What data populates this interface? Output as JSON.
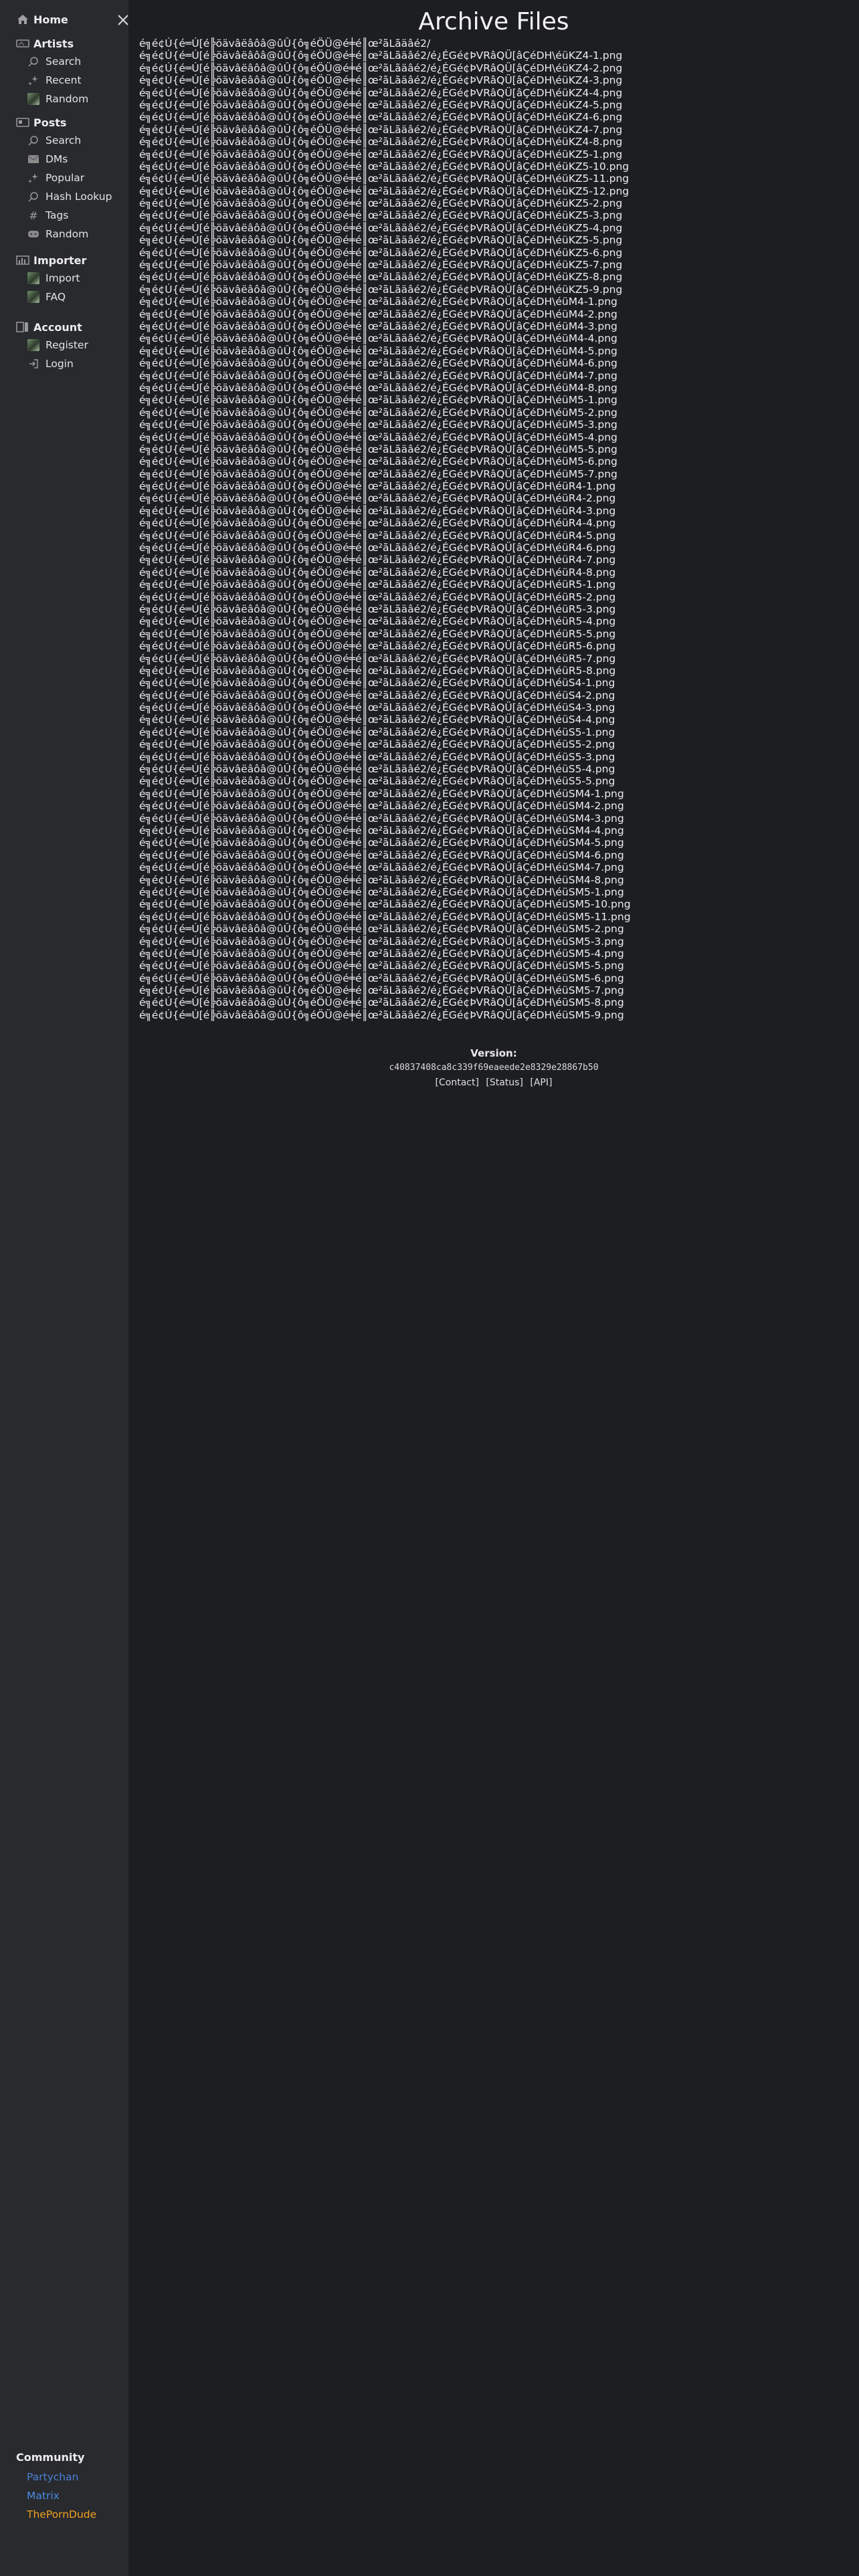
{
  "sidebar": {
    "home_label": "Home",
    "sections": [
      {
        "label": "Artists",
        "icon": "artist-icon",
        "items": [
          {
            "label": "Search",
            "icon": "search-icon"
          },
          {
            "label": "Recent",
            "icon": "sparkle-icon"
          },
          {
            "label": "Random",
            "icon": "image-thumb-icon"
          }
        ]
      },
      {
        "label": "Posts",
        "icon": "posts-icon",
        "items": [
          {
            "label": "Search",
            "icon": "search-icon"
          },
          {
            "label": "DMs",
            "icon": "mail-icon"
          },
          {
            "label": "Popular",
            "icon": "sparkle-icon"
          },
          {
            "label": "Hash Lookup",
            "icon": "search-icon"
          },
          {
            "label": "Tags",
            "icon": "hash-icon"
          },
          {
            "label": "Random",
            "icon": "dice-icon"
          }
        ]
      },
      {
        "label": "Importer",
        "icon": "importer-icon",
        "items": [
          {
            "label": "Import",
            "icon": "image-thumb-icon"
          },
          {
            "label": "FAQ",
            "icon": "image-thumb-icon"
          }
        ]
      },
      {
        "label": "Account",
        "icon": "account-icon",
        "items": [
          {
            "label": "Register",
            "icon": "image-thumb-icon"
          },
          {
            "label": "Login",
            "icon": "login-icon"
          }
        ]
      }
    ],
    "community": {
      "title": "Community",
      "links": [
        {
          "label": "Partychan",
          "color": "#4a7fd4"
        },
        {
          "label": "Matrix",
          "color": "#4a8ae6"
        },
        {
          "label": "ThePornDude",
          "color": "#f0a020"
        }
      ]
    }
  },
  "main": {
    "title": "Archive Files",
    "prefix": "é╗é¢Ú{é═Ú[é╠öävâëâôâ@ûÛ{ô╗éÖÜ@é╪é║œ²ãLãäâé2/",
    "files": [
      "",
      "é¿ÉGé¢ÞVRâQÜ[âÇéDH\\éüKZ4-1.png",
      "é¿ÉGé¢ÞVRâQÜ[âÇéDH\\éüKZ4-2.png",
      "é¿ÉGé¢ÞVRâQÜ[âÇéDH\\éüKZ4-3.png",
      "é¿ÉGé¢ÞVRâQÜ[âÇéDH\\éüKZ4-4.png",
      "é¿ÉGé¢ÞVRâQÜ[âÇéDH\\éüKZ4-5.png",
      "é¿ÉGé¢ÞVRâQÜ[âÇéDH\\éüKZ4-6.png",
      "é¿ÉGé¢ÞVRâQÜ[âÇéDH\\éüKZ4-7.png",
      "é¿ÉGé¢ÞVRâQÜ[âÇéDH\\éüKZ4-8.png",
      "é¿ÉGé¢ÞVRâQÜ[âÇéDH\\éüKZ5-1.png",
      "é¿ÉGé¢ÞVRâQÜ[âÇéDH\\éüKZ5-10.png",
      "é¿ÉGé¢ÞVRâQÜ[âÇéDH\\éüKZ5-11.png",
      "é¿ÉGé¢ÞVRâQÜ[âÇéDH\\éüKZ5-12.png",
      "é¿ÉGé¢ÞVRâQÜ[âÇéDH\\éüKZ5-2.png",
      "é¿ÉGé¢ÞVRâQÜ[âÇéDH\\éüKZ5-3.png",
      "é¿ÉGé¢ÞVRâQÜ[âÇéDH\\éüKZ5-4.png",
      "é¿ÉGé¢ÞVRâQÜ[âÇéDH\\éüKZ5-5.png",
      "é¿ÉGé¢ÞVRâQÜ[âÇéDH\\éüKZ5-6.png",
      "é¿ÉGé¢ÞVRâQÜ[âÇéDH\\éüKZ5-7.png",
      "é¿ÉGé¢ÞVRâQÜ[âÇéDH\\éüKZ5-8.png",
      "é¿ÉGé¢ÞVRâQÜ[âÇéDH\\éüKZ5-9.png",
      "é¿ÉGé¢ÞVRâQÜ[âÇéDH\\éüM4-1.png",
      "é¿ÉGé¢ÞVRâQÜ[âÇéDH\\éüM4-2.png",
      "é¿ÉGé¢ÞVRâQÜ[âÇéDH\\éüM4-3.png",
      "é¿ÉGé¢ÞVRâQÜ[âÇéDH\\éüM4-4.png",
      "é¿ÉGé¢ÞVRâQÜ[âÇéDH\\éüM4-5.png",
      "é¿ÉGé¢ÞVRâQÜ[âÇéDH\\éüM4-6.png",
      "é¿ÉGé¢ÞVRâQÜ[âÇéDH\\éüM4-7.png",
      "é¿ÉGé¢ÞVRâQÜ[âÇéDH\\éüM4-8.png",
      "é¿ÉGé¢ÞVRâQÜ[âÇéDH\\éüM5-1.png",
      "é¿ÉGé¢ÞVRâQÜ[âÇéDH\\éüM5-2.png",
      "é¿ÉGé¢ÞVRâQÜ[âÇéDH\\éüM5-3.png",
      "é¿ÉGé¢ÞVRâQÜ[âÇéDH\\éüM5-4.png",
      "é¿ÉGé¢ÞVRâQÜ[âÇéDH\\éüM5-5.png",
      "é¿ÉGé¢ÞVRâQÜ[âÇéDH\\éüM5-6.png",
      "é¿ÉGé¢ÞVRâQÜ[âÇéDH\\éüM5-7.png",
      "é¿ÉGé¢ÞVRâQÜ[âÇéDH\\éüR4-1.png",
      "é¿ÉGé¢ÞVRâQÜ[âÇéDH\\éüR4-2.png",
      "é¿ÉGé¢ÞVRâQÜ[âÇéDH\\éüR4-3.png",
      "é¿ÉGé¢ÞVRâQÜ[âÇéDH\\éüR4-4.png",
      "é¿ÉGé¢ÞVRâQÜ[âÇéDH\\éüR4-5.png",
      "é¿ÉGé¢ÞVRâQÜ[âÇéDH\\éüR4-6.png",
      "é¿ÉGé¢ÞVRâQÜ[âÇéDH\\éüR4-7.png",
      "é¿ÉGé¢ÞVRâQÜ[âÇéDH\\éüR4-8.png",
      "é¿ÉGé¢ÞVRâQÜ[âÇéDH\\éüR5-1.png",
      "é¿ÉGé¢ÞVRâQÜ[âÇéDH\\éüR5-2.png",
      "é¿ÉGé¢ÞVRâQÜ[âÇéDH\\éüR5-3.png",
      "é¿ÉGé¢ÞVRâQÜ[âÇéDH\\éüR5-4.png",
      "é¿ÉGé¢ÞVRâQÜ[âÇéDH\\éüR5-5.png",
      "é¿ÉGé¢ÞVRâQÜ[âÇéDH\\éüR5-6.png",
      "é¿ÉGé¢ÞVRâQÜ[âÇéDH\\éüR5-7.png",
      "é¿ÉGé¢ÞVRâQÜ[âÇéDH\\éüR5-8.png",
      "é¿ÉGé¢ÞVRâQÜ[âÇéDH\\éüS4-1.png",
      "é¿ÉGé¢ÞVRâQÜ[âÇéDH\\éüS4-2.png",
      "é¿ÉGé¢ÞVRâQÜ[âÇéDH\\éüS4-3.png",
      "é¿ÉGé¢ÞVRâQÜ[âÇéDH\\éüS4-4.png",
      "é¿ÉGé¢ÞVRâQÜ[âÇéDH\\éüS5-1.png",
      "é¿ÉGé¢ÞVRâQÜ[âÇéDH\\éüS5-2.png",
      "é¿ÉGé¢ÞVRâQÜ[âÇéDH\\éüS5-3.png",
      "é¿ÉGé¢ÞVRâQÜ[âÇéDH\\éüS5-4.png",
      "é¿ÉGé¢ÞVRâQÜ[âÇéDH\\éüS5-5.png",
      "é¿ÉGé¢ÞVRâQÜ[âÇéDH\\éüSM4-1.png",
      "é¿ÉGé¢ÞVRâQÜ[âÇéDH\\éüSM4-2.png",
      "é¿ÉGé¢ÞVRâQÜ[âÇéDH\\éüSM4-3.png",
      "é¿ÉGé¢ÞVRâQÜ[âÇéDH\\éüSM4-4.png",
      "é¿ÉGé¢ÞVRâQÜ[âÇéDH\\éüSM4-5.png",
      "é¿ÉGé¢ÞVRâQÜ[âÇéDH\\éüSM4-6.png",
      "é¿ÉGé¢ÞVRâQÜ[âÇéDH\\éüSM4-7.png",
      "é¿ÉGé¢ÞVRâQÜ[âÇéDH\\éüSM4-8.png",
      "é¿ÉGé¢ÞVRâQÜ[âÇéDH\\éüSM5-1.png",
      "é¿ÉGé¢ÞVRâQÜ[âÇéDH\\éüSM5-10.png",
      "é¿ÉGé¢ÞVRâQÜ[âÇéDH\\éüSM5-11.png",
      "é¿ÉGé¢ÞVRâQÜ[âÇéDH\\éüSM5-2.png",
      "é¿ÉGé¢ÞVRâQÜ[âÇéDH\\éüSM5-3.png",
      "é¿ÉGé¢ÞVRâQÜ[âÇéDH\\éüSM5-4.png",
      "é¿ÉGé¢ÞVRâQÜ[âÇéDH\\éüSM5-5.png",
      "é¿ÉGé¢ÞVRâQÜ[âÇéDH\\éüSM5-6.png",
      "é¿ÉGé¢ÞVRâQÜ[âÇéDH\\éüSM5-7.png",
      "é¿ÉGé¢ÞVRâQÜ[âÇéDH\\éüSM5-8.png",
      "é¿ÉGé¢ÞVRâQÜ[âÇéDH\\éüSM5-9.png"
    ]
  },
  "footer": {
    "version_label": "Version:",
    "version_hash": "c40837408ca8c339f69eaeede2e8329e28867b50",
    "links": [
      "[Contact]",
      "[Status]",
      "[API]"
    ]
  }
}
